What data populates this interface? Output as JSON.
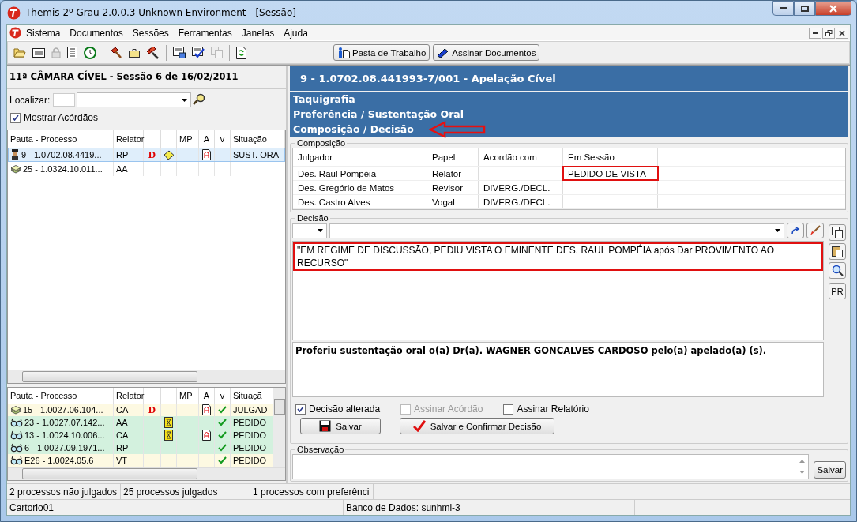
{
  "window": {
    "title": "Themis 2º Grau 2.0.0.3   Unknown Environment - [Sessão]"
  },
  "menu": [
    "Sistema",
    "Documentos",
    "Sessões",
    "Ferramentas",
    "Janelas",
    "Ajuda"
  ],
  "toolbar_buttons": [
    "Pasta de Trabalho",
    "Assinar Documentos"
  ],
  "session": {
    "title": "11ª  CÂMARA CÍVEL - Sessão 6 de 16/02/2011",
    "search_label": "Localizar:",
    "show_checkbox": {
      "label": "Mostrar Acórdãos",
      "checked": true
    }
  },
  "upper_columns": [
    "Pauta - Processo",
    "Relator",
    "MP",
    "A",
    "v",
    "Situação"
  ],
  "upper_rows": [
    {
      "kind": "judge",
      "process": "9 - 1.0702.08.4419...",
      "relator": "RP",
      "d": "D",
      "note": true,
      "doc": true,
      "check": false,
      "status": "SUST. ORA",
      "selected": true
    },
    {
      "kind": "stack",
      "process": "25 - 1.0324.10.011...",
      "relator": "AA",
      "note": false,
      "doc": false,
      "check": false,
      "selected": false
    }
  ],
  "lower_columns": [
    "Pauta - Processo",
    "Relator",
    "MP",
    "A",
    "v",
    "Situaçã"
  ],
  "lower_rows": [
    {
      "kind": "stack",
      "process": "15 - 1.0027.06.104...",
      "relator": "CA",
      "d": "D",
      "note": false,
      "doc": true,
      "check": true,
      "status": "JULGAD",
      "selected": false,
      "color": "#fdf9e2"
    },
    {
      "kind": "glasses",
      "process": "23 - 1.0027.07.142...",
      "relator": "AA",
      "note": true,
      "doc": false,
      "check": true,
      "status": "PEDIDO",
      "selected": false,
      "color": "#d3f1de"
    },
    {
      "kind": "glasses",
      "process": "13 - 1.0024.10.006...",
      "relator": "CA",
      "note": true,
      "doc": true,
      "check": true,
      "status": "PEDIDO",
      "selected": false,
      "color": "#d3f1de"
    },
    {
      "kind": "glasses",
      "process": "6 - 1.0027.09.1971...",
      "relator": "RP",
      "note": false,
      "doc": false,
      "check": true,
      "status": "PEDIDO",
      "selected": false,
      "color": "#d3f1de"
    },
    {
      "kind": "glasses",
      "process": "E26 - 1.0024.05.6",
      "relator": "VT",
      "note": false,
      "doc": false,
      "check": true,
      "status": "PEDIDO",
      "selected": false,
      "color": "#fdf9e2"
    }
  ],
  "process_header": "9   -   1.0702.08.441993-7/001 - Apelação Cível",
  "sections": [
    {
      "label": "Taquigrafia",
      "highlighted": false
    },
    {
      "label": "Preferência / Sustentação Oral",
      "highlighted": false
    },
    {
      "label": "Composição / Decisão",
      "highlighted": true
    }
  ],
  "composition": {
    "title": "Composição",
    "columns": [
      "Julgador",
      "Papel",
      "Acordão com",
      "Em Sessão"
    ],
    "rows": [
      {
        "cells": [
          "Des. Raul Pompéia",
          "Relator",
          "",
          "PEDIDO DE VISTA"
        ],
        "highlighted": true
      },
      {
        "cells": [
          "Des. Gregório de Matos",
          "Revisor",
          "DIVERG./DECL.",
          ""
        ],
        "highlighted": false
      },
      {
        "cells": [
          "Des. Castro Alves",
          "Vogal",
          "DIVERG./DECL.",
          ""
        ],
        "highlighted": false
      }
    ]
  },
  "decision": {
    "title": "Decisão",
    "text": "\"EM REGIME DE DISCUSSÃO, PEDIU VISTA O EMINENTE DES. RAUL POMPÉIA após Dar PROVIMENTO AO RECURSO\"",
    "text_highlighted": true,
    "oral": "Proferiu sustentação oral  o(a) Dr(a). WAGNER GONCALVES CARDOSO pelo(a) apelado(a) (s).",
    "side_button": "PR",
    "checkboxes": [
      {
        "label": "Decisão alterada",
        "checked": true,
        "disabled": false
      },
      {
        "label": "Assinar Acórdão",
        "checked": false,
        "disabled": true
      },
      {
        "label": "Assinar Relatório",
        "checked": false,
        "disabled": false
      }
    ],
    "buttons": [
      {
        "kind": "save",
        "label": "Salvar"
      },
      {
        "kind": "confirm",
        "label": "Salvar e Confirmar Decisão"
      }
    ]
  },
  "observation": {
    "title": "Observação",
    "button": "Salvar"
  },
  "status_bar": [
    "2 processos não julgados",
    "25 processos julgados",
    "1 processos com preferênci"
  ],
  "status_bar_2": [
    "Cartorio01",
    "Banco de Dados: sunhml-3"
  ]
}
